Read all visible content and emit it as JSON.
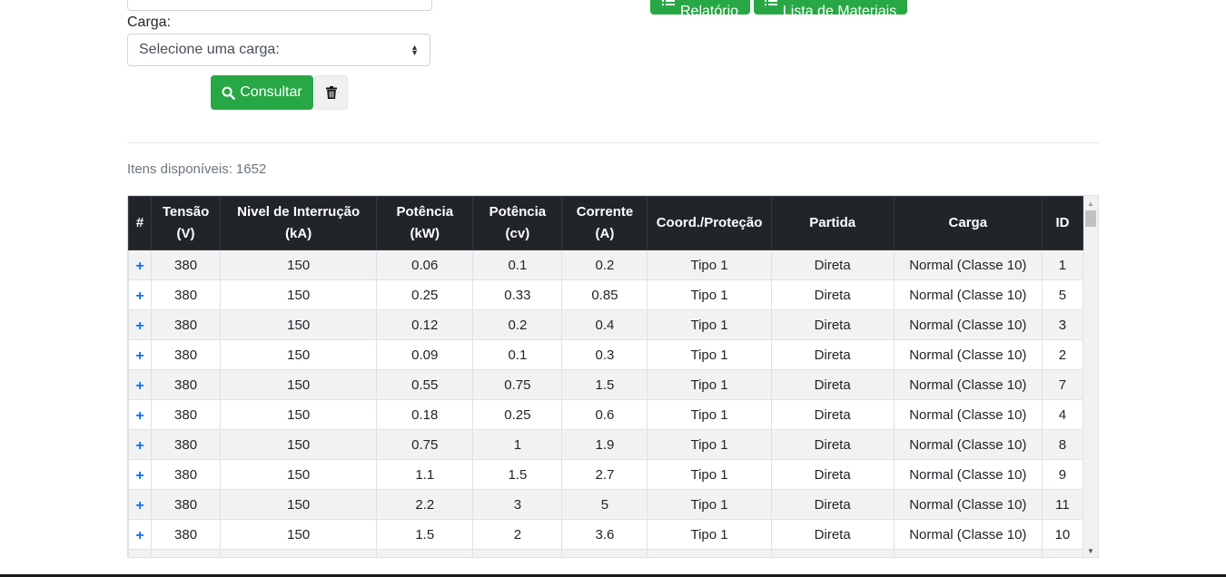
{
  "form": {
    "carga_label": "Carga:",
    "carga_select_value": "Selecione uma carga:",
    "consultar_label": "Consultar"
  },
  "toolbar": {
    "relatorio_label": "Relatório",
    "lista_label": "Lista de Materiais"
  },
  "summary": {
    "label": "Itens disponíveis:",
    "count": "1652"
  },
  "table": {
    "headers": {
      "index": "#",
      "tensao_1": "Tensão",
      "tensao_2": "(V)",
      "nivel_1": "Nivel de Interrução",
      "nivel_2": "(kA)",
      "pot_kw_1": "Potência",
      "pot_kw_2": "(kW)",
      "pot_cv_1": "Potência",
      "pot_cv_2": "(cv)",
      "corrente_1": "Corrente",
      "corrente_2": "(A)",
      "coord": "Coord./Proteção",
      "partida": "Partida",
      "carga": "Carga",
      "id": "ID"
    },
    "plus_symbol": "+",
    "rows": [
      {
        "tensao": "380",
        "nivel": "150",
        "kw": "0.06",
        "cv": "0.1",
        "corrente": "0.2",
        "coord": "Tipo 1",
        "partida": "Direta",
        "carga": "Normal (Classe 10)",
        "id": "1"
      },
      {
        "tensao": "380",
        "nivel": "150",
        "kw": "0.25",
        "cv": "0.33",
        "corrente": "0.85",
        "coord": "Tipo 1",
        "partida": "Direta",
        "carga": "Normal (Classe 10)",
        "id": "5"
      },
      {
        "tensao": "380",
        "nivel": "150",
        "kw": "0.12",
        "cv": "0.2",
        "corrente": "0.4",
        "coord": "Tipo 1",
        "partida": "Direta",
        "carga": "Normal (Classe 10)",
        "id": "3"
      },
      {
        "tensao": "380",
        "nivel": "150",
        "kw": "0.09",
        "cv": "0.1",
        "corrente": "0.3",
        "coord": "Tipo 1",
        "partida": "Direta",
        "carga": "Normal (Classe 10)",
        "id": "2"
      },
      {
        "tensao": "380",
        "nivel": "150",
        "kw": "0.55",
        "cv": "0.75",
        "corrente": "1.5",
        "coord": "Tipo 1",
        "partida": "Direta",
        "carga": "Normal (Classe 10)",
        "id": "7"
      },
      {
        "tensao": "380",
        "nivel": "150",
        "kw": "0.18",
        "cv": "0.25",
        "corrente": "0.6",
        "coord": "Tipo 1",
        "partida": "Direta",
        "carga": "Normal (Classe 10)",
        "id": "4"
      },
      {
        "tensao": "380",
        "nivel": "150",
        "kw": "0.75",
        "cv": "1",
        "corrente": "1.9",
        "coord": "Tipo 1",
        "partida": "Direta",
        "carga": "Normal (Classe 10)",
        "id": "8"
      },
      {
        "tensao": "380",
        "nivel": "150",
        "kw": "1.1",
        "cv": "1.5",
        "corrente": "2.7",
        "coord": "Tipo 1",
        "partida": "Direta",
        "carga": "Normal (Classe 10)",
        "id": "9"
      },
      {
        "tensao": "380",
        "nivel": "150",
        "kw": "2.2",
        "cv": "3",
        "corrente": "5",
        "coord": "Tipo 1",
        "partida": "Direta",
        "carga": "Normal (Classe 10)",
        "id": "11"
      },
      {
        "tensao": "380",
        "nivel": "150",
        "kw": "1.5",
        "cv": "2",
        "corrente": "3.6",
        "coord": "Tipo 1",
        "partida": "Direta",
        "carga": "Normal (Classe 10)",
        "id": "10"
      }
    ]
  },
  "colors": {
    "success": "#28a745",
    "table_header": "#212529",
    "link_blue": "#0d6efd"
  }
}
